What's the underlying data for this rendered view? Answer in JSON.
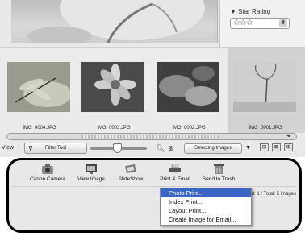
{
  "filter_panel": {
    "star_rating_label": "▼ Star Rating",
    "star_rating_value": "☆☆☆"
  },
  "thumbnails": [
    {
      "filename": "IMG_0004.JPG",
      "selected": false
    },
    {
      "filename": "IMG_0003.JPG",
      "selected": false
    },
    {
      "filename": "IMG_0002.JPG",
      "selected": false
    },
    {
      "filename": "IMG_0001.JPG",
      "selected": true
    }
  ],
  "toolbar": {
    "view_label": "View",
    "filter_tool_label": "Filter Tool",
    "selecting_images_label": "Selecting Images"
  },
  "actions": [
    {
      "label": "Canon Camera",
      "icon": "camera-icon"
    },
    {
      "label": "View Image",
      "icon": "monitor-icon"
    },
    {
      "label": "SlideShow",
      "icon": "slideshow-icon"
    },
    {
      "label": "Print & Email",
      "icon": "printer-icon"
    },
    {
      "label": "Send to Trash",
      "icon": "trash-icon"
    }
  ],
  "status_text": "cted: 1 / Total: 5 images",
  "menu": {
    "items": [
      "Photo Print...",
      "Index Print...",
      "Layout Print...",
      "Create Image for Email..."
    ],
    "highlighted_index": 0
  },
  "colors": {
    "menu_highlight": "#3a66c6",
    "panel_border": "#000000"
  }
}
